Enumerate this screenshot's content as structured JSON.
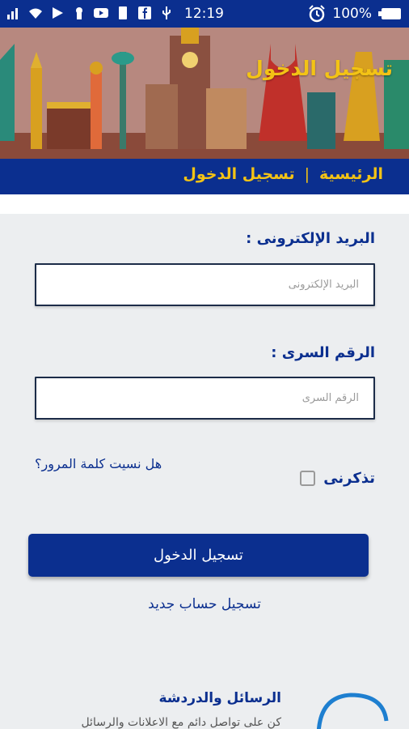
{
  "status_bar": {
    "time": "12:19",
    "battery": "100%",
    "icons": [
      "signal-icon",
      "wifi-icon",
      "play-store-icon",
      "keyhole-icon",
      "youtube-icon",
      "sim-icon",
      "facebook-icon",
      "usb-icon",
      "alarm-icon",
      "battery-icon"
    ]
  },
  "header": {
    "title": "تسجيل الدخول"
  },
  "breadcrumb": {
    "home": "الرئيسية",
    "separator": "|",
    "current": "تسجيل الدخول"
  },
  "form": {
    "email_label": "البريد الإلكترونى :",
    "email_placeholder": "البريد الإلكترونى",
    "email_value": "",
    "password_label": "الرقم السرى :",
    "password_placeholder": "الرقم السرى",
    "password_value": "",
    "forgot_password": "هل نسيت كلمة المرور؟",
    "remember_me": "تذكرنى",
    "remember_checked": false,
    "login_button": "تسجيل الدخول",
    "register_link": "تسجيل حساب جديد"
  },
  "messages_section": {
    "title": "الرسائل والدردشة",
    "description": "كن على تواصل دائم مع الاعلانات والرسائل"
  },
  "colors": {
    "primary": "#0b2f8f",
    "accent": "#f3c315",
    "background": "#eceef0"
  }
}
